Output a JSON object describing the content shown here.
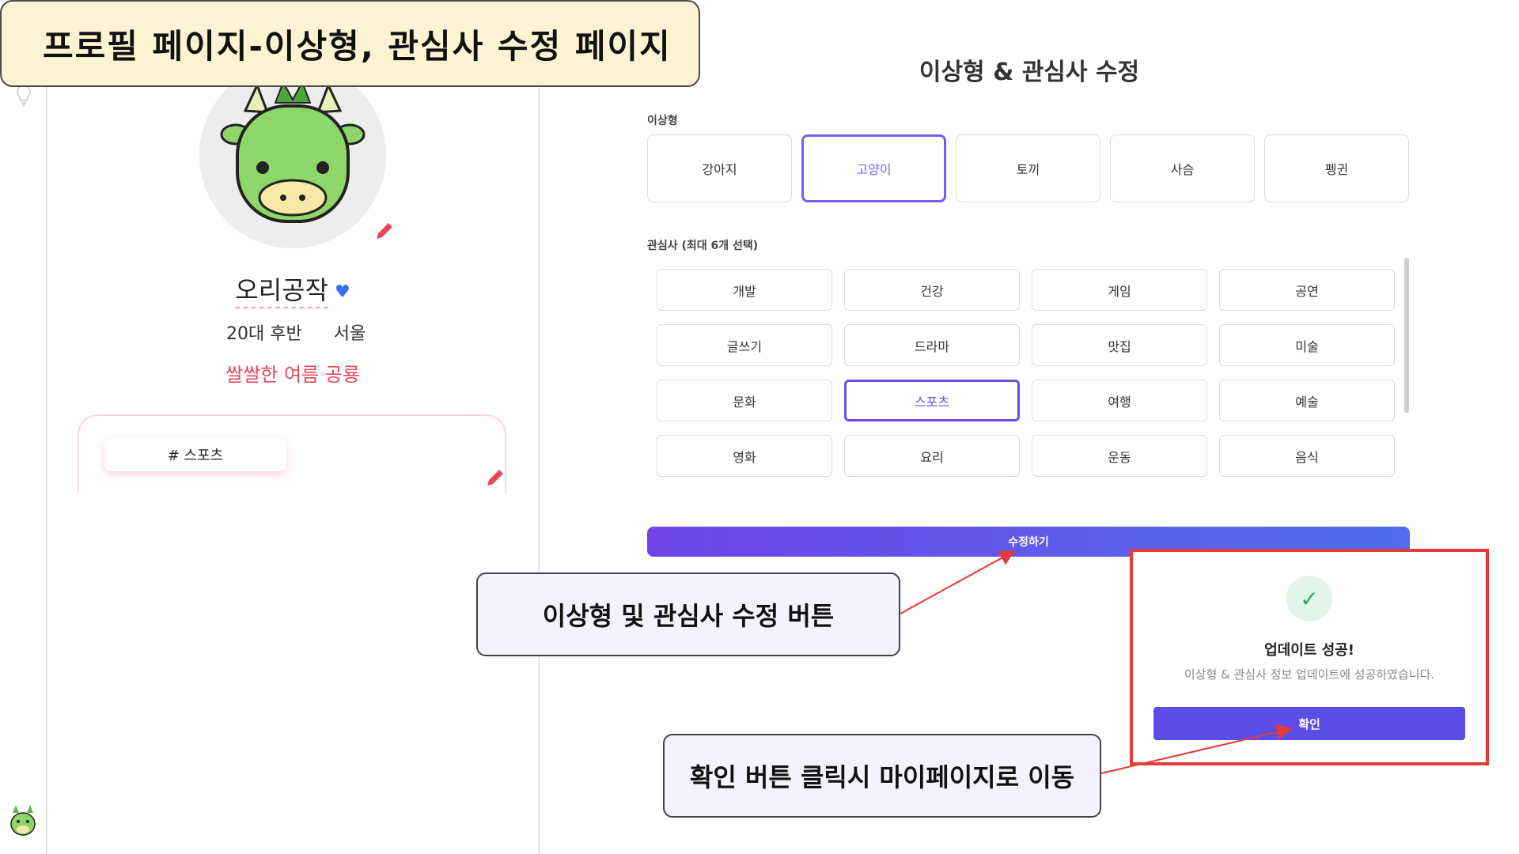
{
  "banner": {
    "title": "프로필 페이지-이상형, 관심사 수정 페이지"
  },
  "profile": {
    "nickname": "오리공작",
    "age_group": "20대 후반",
    "city": "서울",
    "status_message": "쌀쌀한 여름 공룡",
    "interest_tag": "# 스포츠"
  },
  "panel": {
    "title": "이상형 & 관심사 수정",
    "ideal_label": "이상형",
    "ideal_types": [
      {
        "label": "강아지",
        "selected": false
      },
      {
        "label": "고양이",
        "selected": true
      },
      {
        "label": "토끼",
        "selected": false
      },
      {
        "label": "사슴",
        "selected": false
      },
      {
        "label": "펭귄",
        "selected": false
      }
    ],
    "interests_label": "관심사 (최대 6개 선택)",
    "interests": [
      {
        "label": "개발",
        "selected": false
      },
      {
        "label": "건강",
        "selected": false
      },
      {
        "label": "게임",
        "selected": false
      },
      {
        "label": "공연",
        "selected": false
      },
      {
        "label": "글쓰기",
        "selected": false
      },
      {
        "label": "드라마",
        "selected": false
      },
      {
        "label": "맛집",
        "selected": false
      },
      {
        "label": "미술",
        "selected": false
      },
      {
        "label": "문화",
        "selected": false
      },
      {
        "label": "스포츠",
        "selected": true
      },
      {
        "label": "여행",
        "selected": false
      },
      {
        "label": "예술",
        "selected": false
      },
      {
        "label": "영화",
        "selected": false
      },
      {
        "label": "요리",
        "selected": false
      },
      {
        "label": "운동",
        "selected": false
      },
      {
        "label": "음식",
        "selected": false
      }
    ],
    "submit_label": "수정하기"
  },
  "modal": {
    "title": "업데이트 성공!",
    "description": "이상형 & 관심사 정보 업데이트에 성공하였습니다.",
    "confirm_label": "확인"
  },
  "annotations": {
    "submit_note": "이상형 및 관심사 수정 버튼",
    "confirm_note": "확인 버튼 클릭시 마이페이지로 이동"
  },
  "colors": {
    "accent_purple": "#7c5cf0",
    "confirm_button": "#5b4de8",
    "status_red": "#e8475a",
    "modal_border": "#e53b3b",
    "heart_blue": "#3b6ef5",
    "banner_bg": "#fdf3d2"
  },
  "icons": [
    "lightbulb-icon",
    "dinosaur-avatar",
    "pencil-icon",
    "heart-icon",
    "check-icon"
  ]
}
